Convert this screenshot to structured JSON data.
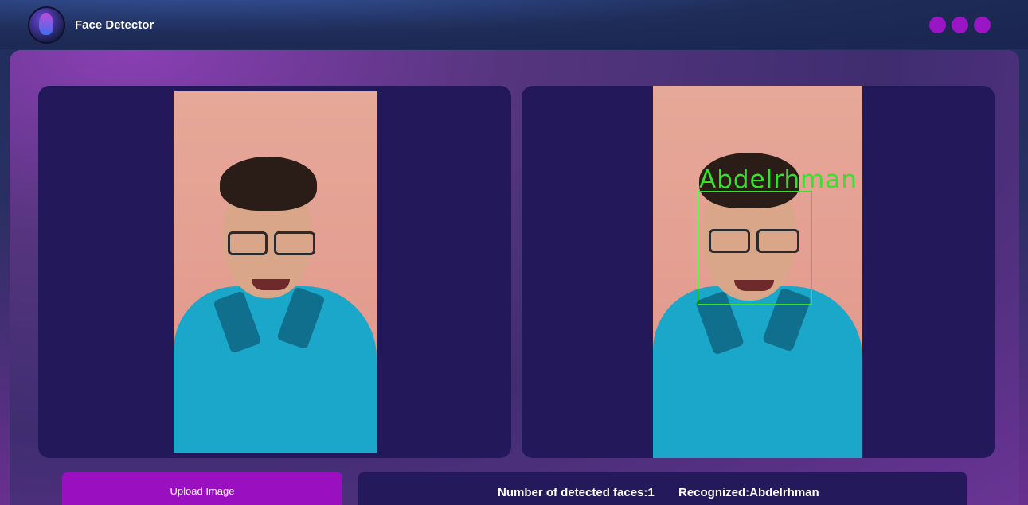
{
  "app": {
    "title": "Face Detector",
    "logo_icon": "face-head-logo-icon",
    "window_buttons": [
      "dot-1",
      "dot-2",
      "dot-3"
    ],
    "window_button_color": "#9a16c4"
  },
  "input_image": {
    "description_icon": "photo"
  },
  "output_image": {
    "recognized_label": "Abdelrhman",
    "box_color": "#39e02d"
  },
  "actions": {
    "upload_label": "Upload Image"
  },
  "results": {
    "faces_text": "Number of detected faces:1",
    "recognized_text": "Recognized:Abdelrhman"
  },
  "colors": {
    "card_bg": "#23185a",
    "accent": "#9a10c0"
  }
}
